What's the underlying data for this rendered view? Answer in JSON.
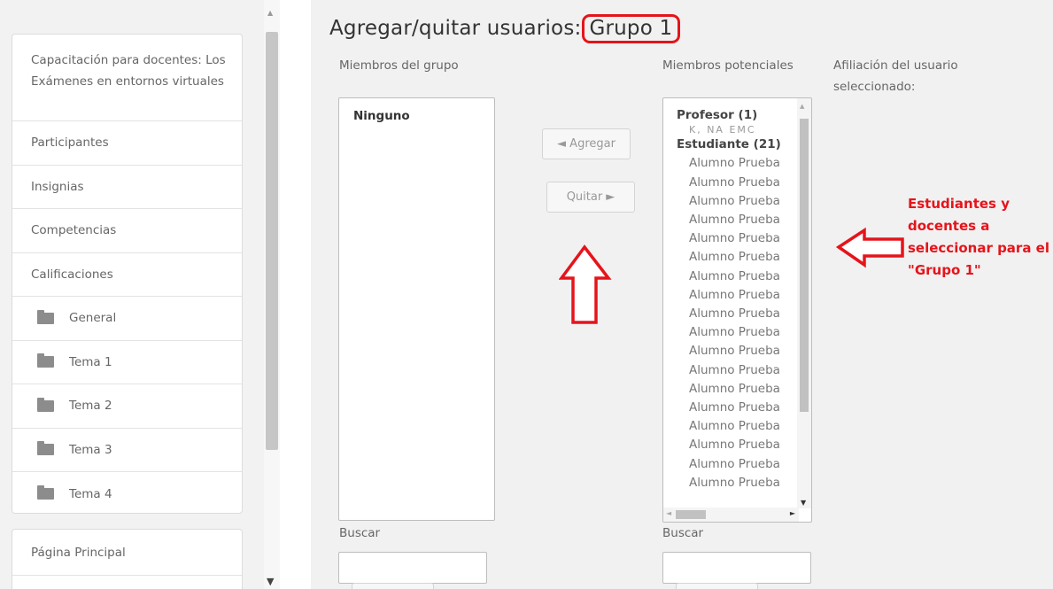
{
  "sidebar": {
    "course_title": "Capacitación para docentes: Los Exámenes en entornos virtuales",
    "items": [
      {
        "label": "Participantes"
      },
      {
        "label": "Insignias"
      },
      {
        "label": "Competencias"
      },
      {
        "label": "Calificaciones"
      }
    ],
    "sections": [
      {
        "label": "General",
        "icon": "folder-icon"
      },
      {
        "label": "Tema 1",
        "icon": "folder-icon"
      },
      {
        "label": "Tema 2",
        "icon": "folder-icon"
      },
      {
        "label": "Tema 3",
        "icon": "folder-icon"
      },
      {
        "label": "Tema 4",
        "icon": "folder-icon"
      }
    ],
    "main_page_label": "Página Principal"
  },
  "main": {
    "title_prefix": "Agregar/quitar usuarios:",
    "title_group": "Grupo 1",
    "members_label": "Miembros del grupo",
    "members_empty": "Ninguno",
    "potential_label": "Miembros potenciales",
    "affiliation_label": "Afiliación del usuario seleccionado:",
    "add_button": "◄ Agregar",
    "remove_button": "Quitar ►",
    "potential": {
      "teacher_group": "Profesor (1)",
      "teacher_obscured": "K, NA EMC",
      "student_group": "Estudiante (21)",
      "students": [
        "Alumno Prueba",
        "Alumno Prueba",
        "Alumno Prueba",
        "Alumno Prueba",
        "Alumno Prueba",
        "Alumno Prueba",
        "Alumno Prueba",
        "Alumno Prueba",
        "Alumno Prueba",
        "Alumno Prueba",
        "Alumno Prueba",
        "Alumno Prueba",
        "Alumno Prueba",
        "Alumno Prueba",
        "Alumno Prueba",
        "Alumno Prueba",
        "Alumno Prueba",
        "Alumno Prueba"
      ]
    },
    "search_label": "Buscar",
    "search_members_value": "",
    "search_potential_value": ""
  },
  "annotation": {
    "text": "Estudiantes y docentes a seleccionar para el \"Grupo 1\"",
    "color": "#e5141b"
  }
}
